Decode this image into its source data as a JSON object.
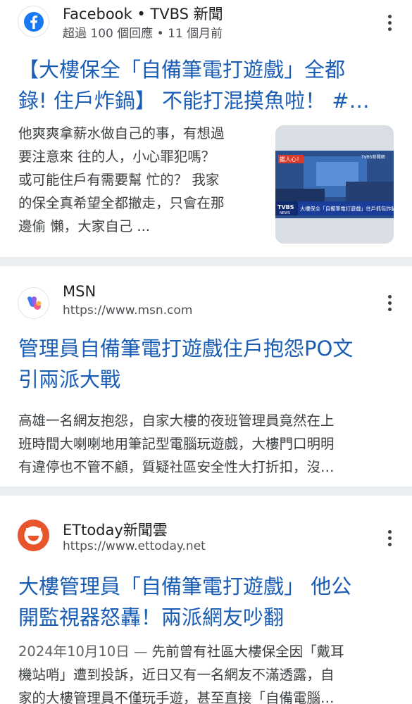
{
  "results": [
    {
      "source": "Facebook • TVBS 新聞",
      "meta": "超過 100 個回應 • 11 個月前",
      "icon": "facebook-icon",
      "title_lines": [
        "【大樓保全「自備筆電打遊戲」全都",
        "錄! 住戶炸鍋】 不能打混摸魚啦！ #…"
      ],
      "snippet_lines": [
        "他爽爽拿薪水做自己的事，有想過",
        "要注意來 往的人，小心罪犯嗎？",
        "或可能住戶有需要幫 忙的？ 我家",
        "的保全真希望全都撤走，只會在那",
        "邊偷 懶，大家自己 ..."
      ],
      "thumbnail": {
        "tag": "鑑人心！",
        "corner": "TVBS新聞網",
        "brand": "TVBS",
        "brand_sub": "NEWS",
        "caption": "大樓保全「自備筆電打遊戲」住戶抓包炸鍋"
      }
    },
    {
      "source": "MSN",
      "meta": "https://www.msn.com",
      "icon": "msn-icon",
      "title_lines": [
        "管理員自備筆電打遊戲住戶抱怨PO文",
        "引兩派大戰"
      ],
      "snippet_lines": [
        "高雄一名網友抱怨，自家大樓的夜班管理員竟然在上",
        "班時間大喇喇地用筆記型電腦玩遊戲，大樓門口明明",
        "有違停也不管不顧，質疑社區安全性大打折扣，沒…"
      ]
    },
    {
      "source": "ETtoday新聞雲",
      "meta": "https://www.ettoday.net",
      "icon": "ettoday-icon",
      "title_lines": [
        "大樓管理員「自備筆電打遊戲」 他公",
        "開監視器怒轟！兩派網友吵翻"
      ],
      "snippet_date": "2024年10月10日",
      "snippet_dash": "—",
      "snippet_lines": [
        "先前曾有社區大樓保全因「戴耳",
        "機站哨」遭到投訴，近日又有一名網友不滿透露，自",
        "家的大樓管理員不僅玩手遊，甚至直接「自備電腦…"
      ]
    }
  ],
  "colors": {
    "link": "#1a5db4",
    "facebook": "#1877f2",
    "ettoday": "#e8552c",
    "separator": "#eceff2"
  }
}
